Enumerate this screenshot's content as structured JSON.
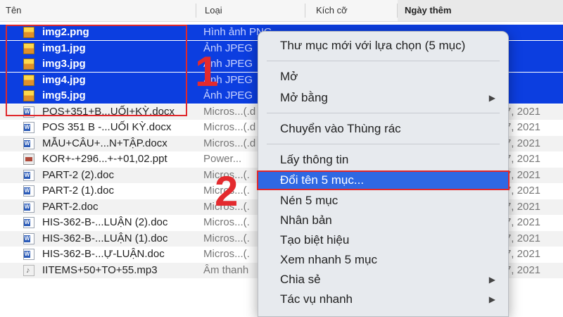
{
  "columns": {
    "name": "Tên",
    "kind": "Loại",
    "size": "Kích cỡ",
    "date": "Ngày thêm"
  },
  "files": [
    {
      "name": "img2.png",
      "kind": "Hình ảnh PNG",
      "size": "",
      "date": "",
      "icon": "image-icon",
      "selected": true
    },
    {
      "name": "img1.jpg",
      "kind": "Ảnh JPEG",
      "size": "",
      "date": "",
      "icon": "image-icon",
      "selected": true
    },
    {
      "name": "img3.jpg",
      "kind": "Ảnh JPEG",
      "size": "",
      "date": "",
      "icon": "image-icon",
      "selected": true
    },
    {
      "name": "img4.jpg",
      "kind": "Ảnh JPEG",
      "size": "",
      "date": "",
      "icon": "image-icon",
      "selected": true
    },
    {
      "name": "img5.jpg",
      "kind": "Ảnh JPEG",
      "size": "",
      "date": "",
      "icon": "image-icon",
      "selected": true
    },
    {
      "name": "POS+351+B...UỐI+KỲ.docx",
      "kind": "Micros...(.d",
      "size": "",
      "date": "7, 2021",
      "icon": "word-document-icon",
      "selected": false
    },
    {
      "name": "POS 351 B -...UỐI KỲ.docx",
      "kind": "Micros...(.d",
      "size": "",
      "date": "7, 2021",
      "icon": "word-document-icon",
      "selected": false
    },
    {
      "name": "MẪU+CÂU+...N+TẬP.docx",
      "kind": "Micros...(.d",
      "size": "",
      "date": "7, 2021",
      "icon": "word-document-icon",
      "selected": false
    },
    {
      "name": "KOR+-+296...+-+01,02.ppt",
      "kind": "Power...",
      "size": "",
      "date": "7, 2021",
      "icon": "powerpoint-icon",
      "selected": false
    },
    {
      "name": "PART-2 (2).doc",
      "kind": "Micros...(.",
      "size": "",
      "date": "7, 2021",
      "icon": "word-document-icon",
      "selected": false
    },
    {
      "name": "PART-2 (1).doc",
      "kind": "Micros...(.",
      "size": "",
      "date": "7, 2021",
      "icon": "word-document-icon",
      "selected": false
    },
    {
      "name": "PART-2.doc",
      "kind": "Micros...(.",
      "size": "",
      "date": "7, 2021",
      "icon": "word-document-icon",
      "selected": false
    },
    {
      "name": "HIS-362-B-...LUẬN (2).doc",
      "kind": "Micros...(.",
      "size": "",
      "date": "7, 2021",
      "icon": "word-document-icon",
      "selected": false
    },
    {
      "name": "HIS-362-B-...LUẬN (1).doc",
      "kind": "Micros...(.",
      "size": "",
      "date": "7, 2021",
      "icon": "word-document-icon",
      "selected": false
    },
    {
      "name": "HIS-362-B-...Ự-LUẬN.doc",
      "kind": "Micros...(.",
      "size": "",
      "date": "7, 2021",
      "icon": "word-document-icon",
      "selected": false
    },
    {
      "name": "IITEMS+50+TO+55.mp3",
      "kind": "Âm thanh",
      "size": "",
      "date": "7, 2021",
      "icon": "audio-file-icon",
      "selected": false
    }
  ],
  "context_menu": {
    "items": [
      {
        "label": "Thư mục mới với lựa chọn (5 mục)",
        "submenu": false
      },
      {
        "label": "Mở",
        "submenu": false
      },
      {
        "label": "Mở bằng",
        "submenu": true
      },
      {
        "label": "Chuyển vào Thùng rác",
        "submenu": false
      },
      {
        "label": "Lấy thông tin",
        "submenu": false
      },
      {
        "label": "Đổi tên 5 mục...",
        "submenu": false,
        "highlighted": true
      },
      {
        "label": "Nén 5 mục",
        "submenu": false
      },
      {
        "label": "Nhân bản",
        "submenu": false
      },
      {
        "label": "Tạo biệt hiệu",
        "submenu": false
      },
      {
        "label": "Xem nhanh 5 mục",
        "submenu": false
      },
      {
        "label": "Chia sẻ",
        "submenu": true
      },
      {
        "label": "Tác vụ nhanh",
        "submenu": true
      }
    ],
    "submenu_arrow": "▶"
  },
  "annotations": {
    "step1": "1",
    "step2": "2",
    "highlight_color": "#e0282c"
  },
  "colors": {
    "selection": "#0c3ee0",
    "menu_highlight": "#2f68e3"
  }
}
